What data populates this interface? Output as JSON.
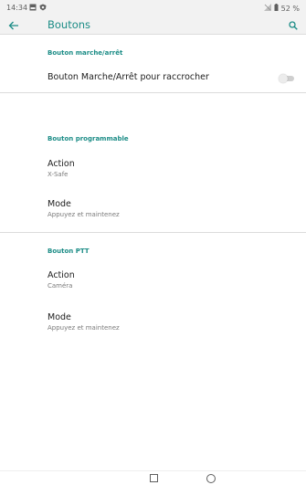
{
  "status_bar": {
    "time": "14:34",
    "battery": "52 %"
  },
  "app_bar": {
    "title": "Boutons"
  },
  "sections": [
    {
      "header": "Bouton marche/arrêt",
      "items": [
        {
          "title": "Bouton Marche/Arrêt pour raccrocher",
          "toggle_on": false
        }
      ]
    },
    {
      "header": "Bouton programmable",
      "items": [
        {
          "title": "Action",
          "summary": "X-Safe"
        },
        {
          "title": "Mode",
          "summary": "Appuyez et maintenez"
        }
      ]
    },
    {
      "header": "Bouton PTT",
      "items": [
        {
          "title": "Action",
          "summary": "Caméra"
        },
        {
          "title": "Mode",
          "summary": "Appuyez et maintenez"
        }
      ]
    }
  ],
  "colors": {
    "accent": "#1b8c86",
    "bar_background": "#f2f2f2",
    "summary_text": "#7a7a7a"
  },
  "icons": {
    "back": "arrow-left-icon",
    "search": "search-icon",
    "status_image": "image-icon",
    "status_shield": "shield-icon",
    "signal": "signal-off-icon",
    "battery": "battery-icon"
  }
}
